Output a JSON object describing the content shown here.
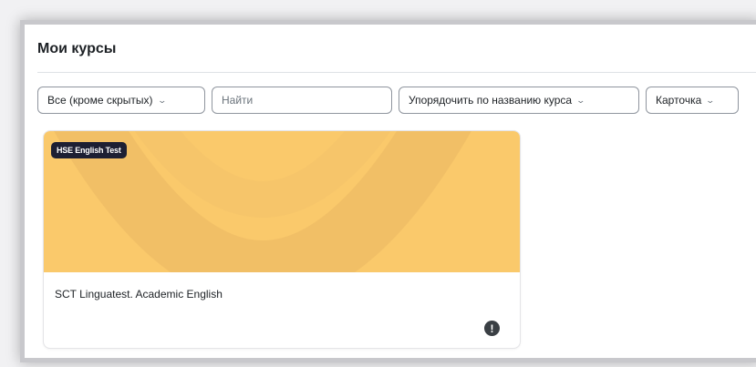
{
  "page": {
    "title": "Мои курсы"
  },
  "filters": {
    "grouping": {
      "label": "Все (кроме скрытых)",
      "icon": "chevron-down-icon"
    },
    "search": {
      "placeholder": "Найти",
      "value": ""
    },
    "sort": {
      "label": "Упорядочить по названию курса",
      "icon": "chevron-down-icon"
    },
    "view": {
      "label": "Карточка",
      "icon": "chevron-down-icon"
    }
  },
  "courses": [
    {
      "category_badge": "HSE English Test",
      "name": "SCT Linguatest. Academic English",
      "image_color": "#fac96b",
      "menu_icon": "more-options-icon"
    }
  ],
  "colors": {
    "badge_bg": "#1d1f33",
    "card_image": "#fac96b",
    "border": "#8f959e"
  }
}
